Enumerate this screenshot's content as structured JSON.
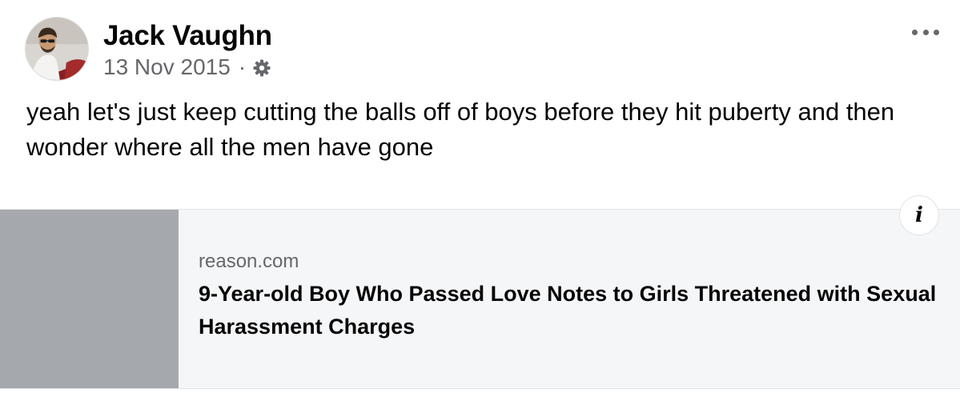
{
  "post": {
    "author": "Jack Vaughn",
    "date": "13 Nov 2015",
    "separator": "·",
    "privacy_icon": "gear-icon",
    "more_icon": "more-options-icon",
    "text": "yeah let's just keep cutting the balls off of boys before they hit puberty and then wonder where all the men have gone"
  },
  "link_preview": {
    "domain": "reason.com",
    "title": "9-Year-old Boy Who Passed Love Notes to Girls Threatened with Sexual Harassment Charges",
    "info_label": "i",
    "thumbnail_color": "#a5a8ad"
  }
}
